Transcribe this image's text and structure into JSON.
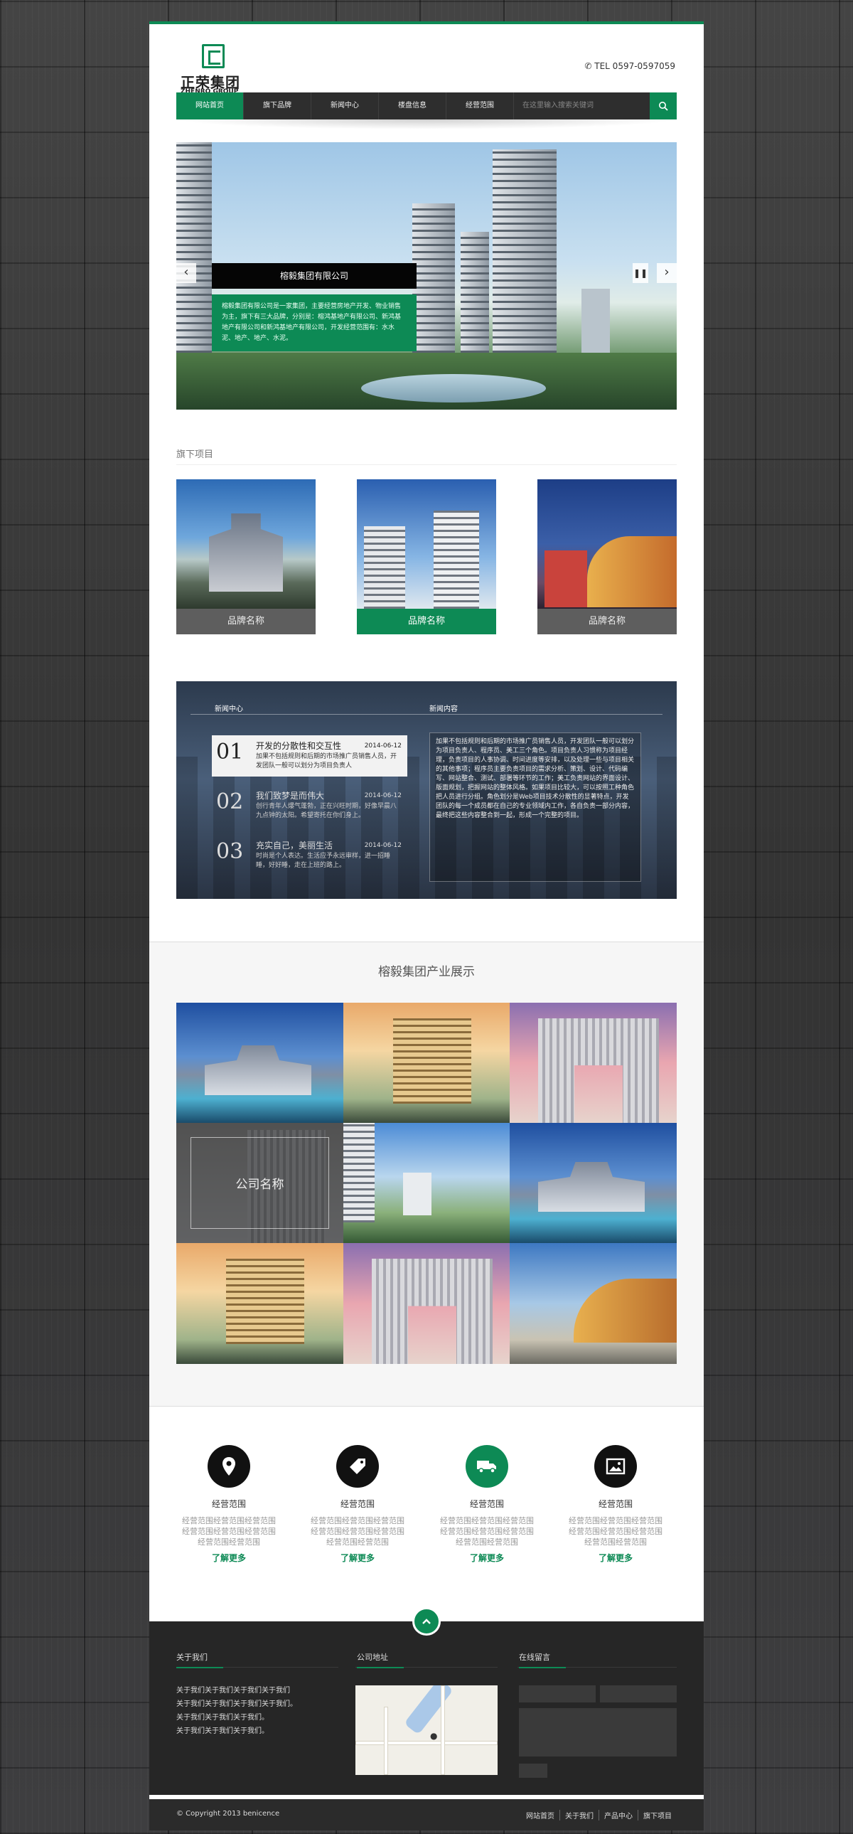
{
  "header": {
    "logo_cn": "正荣集团",
    "logo_en": "ZHENRO GROUP",
    "tel": "TEL 0597-0597059"
  },
  "nav": {
    "items": [
      {
        "label": "网站首页",
        "active": true
      },
      {
        "label": "旗下品牌"
      },
      {
        "label": "新闻中心"
      },
      {
        "label": "楼盘信息"
      },
      {
        "label": "经营范围"
      }
    ],
    "search_placeholder": "在这里输入搜索关键词"
  },
  "banner": {
    "title": "榕毅集团有限公司",
    "desc": "榕毅集团有限公司是一家集团，主要经营房地产开发、物业销售为主，旗下有三大品牌，分别是：榕鸿基地产有限公司、新鸿基地产有限公司和新鸿基地产有限公司，开发经营范围有：水水泥、地产、地产、水泥。",
    "prev_icon": "chevron-left-icon",
    "next_icon": "chevron-right-icon",
    "pause_icon": "pause-icon"
  },
  "brands": {
    "title": "旗下项目",
    "items": [
      {
        "label": "品牌名称"
      },
      {
        "label": "品牌名称",
        "highlight": true
      },
      {
        "label": "品牌名称"
      }
    ]
  },
  "news": {
    "left_header": "新闻中心",
    "right_header": "新闻内容",
    "items": [
      {
        "num": "01",
        "title": "开发的分散性和交互性",
        "date": "2014-06-12",
        "desc": "加果不包括规则和后期的市场推广员销售人员，开发团队一般可以划分为项目负责人"
      },
      {
        "num": "02",
        "title": "我们致梦是而伟大",
        "date": "2014-06-12",
        "desc": "创行青年人爆气蓬勃，正在兴旺时期，好像早晨八九点钟的太阳。希望寄托在你们身上。"
      },
      {
        "num": "03",
        "title": "充实自己，美丽生活",
        "date": "2014-06-12",
        "desc": "时尚是个人表达。生活应予永远审样，进一招睡睡，好好睡，走在上班的路上。"
      }
    ],
    "content": "加果不包括规则和后期的市场推广员销售人员，开发团队一般可以划分为项目负责人、程序员、美工三个角色。项目负责人习惯称为项目经理，负责项目的人事协调、时间进度等安排，以及处理一些与项目相关的其他事项；程序员主要负责项目的需求分析、策划、设计、代码编写、网站整合、测试、部署等环节的工作；美工负责网站的界面设计、版面规划，把握网站的整体风格。如果项目比较大，可以按照工种角色把人员进行分组。角色划分是Web项目技术分散性的显著特点，开发团队的每一个成员都在自己的专业领域内工作，各自负责一部分内容，最终把这些内容整合到一起，形成一个完整的项目。"
  },
  "industry": {
    "title": "榕毅集团产业展示",
    "featured_label": "公司名称"
  },
  "services": [
    {
      "icon": "location-pin-icon",
      "name": "经营范围",
      "desc": "经营范围经营范围经营范围经营范围经营范围经营范围经营范围经营范围",
      "more": "了解更多"
    },
    {
      "icon": "price-tag-icon",
      "name": "经营范围",
      "desc": "经营范围经营范围经营范围经营范围经营范围经营范围经营范围经营范围",
      "more": "了解更多"
    },
    {
      "icon": "truck-icon",
      "name": "经营范围",
      "desc": "经营范围经营范围经营范围经营范围经营范围经营范围经营范围经营范围",
      "more": "了解更多"
    },
    {
      "icon": "picture-icon",
      "name": "经营范围",
      "desc": "经营范围经营范围经营范围经营范围经营范围经营范围经营范围经营范围",
      "more": "了解更多"
    }
  ],
  "footer": {
    "about_title": "关于我们",
    "about_lines": [
      "关于我们关于我们关于我们关于我们",
      "关于我们关于我们关于我们关于我们。",
      "关于我们关于我们关于我们。",
      "关于我们关于我们关于我们。"
    ],
    "address_title": "公司地址",
    "message_title": "在线留言",
    "copyright": "© Copyright 2013 benicence",
    "links": [
      "网站首页",
      "关于我们",
      "产品中心",
      "旗下项目"
    ]
  },
  "colors": {
    "accent": "#0d8a55",
    "dark": "#262626"
  }
}
